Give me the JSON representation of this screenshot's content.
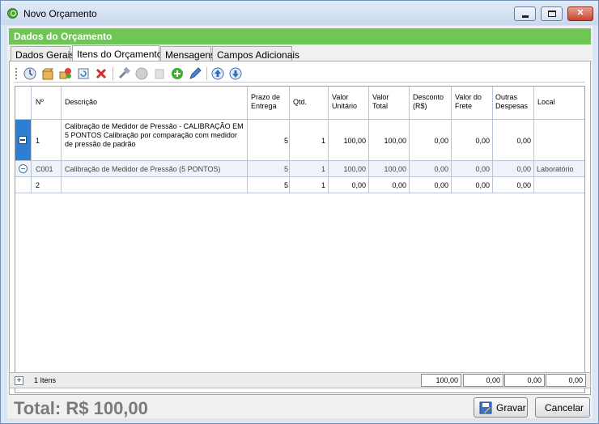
{
  "window": {
    "title": "Novo Orçamento"
  },
  "header": {
    "title": "Dados do Orçamento"
  },
  "tabs": [
    {
      "label": "Dados Gerais"
    },
    {
      "label": "Itens do Orçamento"
    },
    {
      "label": "Mensagens"
    },
    {
      "label": "Campos Adicionais"
    }
  ],
  "toolbar": {
    "icons": [
      "clock-refresh-icon",
      "box-icon",
      "multi-item-icon",
      "refresh-icon",
      "delete-icon",
      "hammer-icon",
      "disabled-circle-icon",
      "disabled-doc-icon",
      "add-icon",
      "edit-icon",
      "arrow-up-icon",
      "arrow-down-icon"
    ]
  },
  "grid": {
    "columns": {
      "num": "Nº",
      "desc": "Descrição",
      "prazo": "Prazo de Entrega",
      "qtd": "Qtd.",
      "vunit": "Valor Unitário",
      "vtotal": "Valor Total",
      "desconto": "Desconto (R$)",
      "frete": "Valor do Frete",
      "outras": "Outras Despesas",
      "local": "Local"
    },
    "rows": [
      {
        "num": "1",
        "desc": "Calibração de Medidor de Pressão - CALIBRAÇÃO EM 5 PONTOS Calibração por comparação com medidor de pressão de padrão",
        "prazo": "5",
        "qtd": "1",
        "vunit": "100,00",
        "vtotal": "100,00",
        "desconto": "0,00",
        "frete": "0,00",
        "outras": "0,00",
        "local": ""
      },
      {
        "num": "C001",
        "desc": "Calibração de Medidor de Pressão (5 PONTOS)",
        "prazo": "5",
        "qtd": "1",
        "vunit": "100,00",
        "vtotal": "100,00",
        "desconto": "0,00",
        "frete": "0,00",
        "outras": "0,00",
        "local": "Laboratório"
      },
      {
        "num": "2",
        "desc": "",
        "prazo": "5",
        "qtd": "1",
        "vunit": "0,00",
        "vtotal": "0,00",
        "desconto": "0,00",
        "frete": "0,00",
        "outras": "0,00",
        "local": ""
      }
    ]
  },
  "summary": {
    "items_label": "1 Itens",
    "totals": [
      "100,00",
      "0,00",
      "0,00",
      "0,00"
    ]
  },
  "footer": {
    "total": "Total: R$ 100,00",
    "save_label": "Gravar",
    "cancel_label": "Cancelar"
  },
  "colors": {
    "accent_green": "#6fc655",
    "selection_blue": "#2e7ed1"
  }
}
